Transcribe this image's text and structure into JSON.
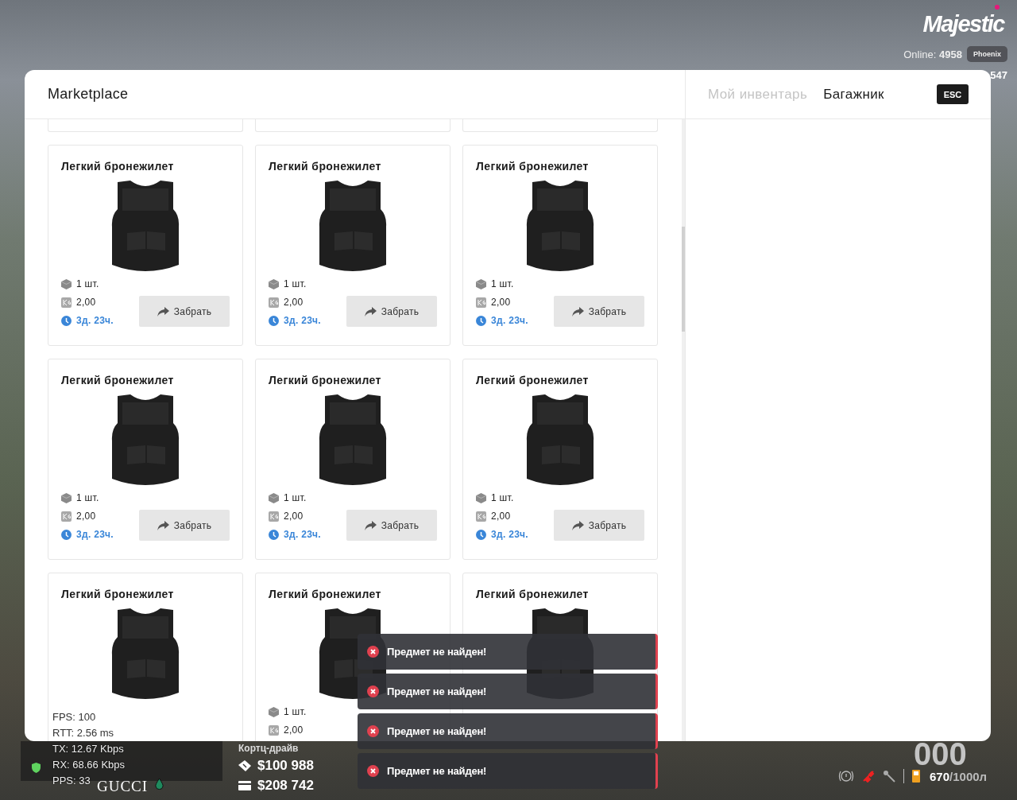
{
  "hud": {
    "logo": "Majestic",
    "online_label": "Online:",
    "online_count": "4958",
    "server": "Phoenix",
    "id_fragment": "547",
    "net_stats": [
      {
        "label": "FPS:",
        "value": "100"
      },
      {
        "label": "RTT:",
        "value": "2.56 ms"
      },
      {
        "label": "TX:",
        "value": "12.67 Kbps"
      },
      {
        "label": "RX:",
        "value": "68.66 Kbps"
      },
      {
        "label": "PPS:",
        "value": "33"
      }
    ],
    "brand": "GUCCI",
    "location": "Кортц-драйв",
    "cash": "$100 988",
    "bank": "$208 742",
    "speed": "000",
    "fuel": "670",
    "fuel_capacity": "/1000л"
  },
  "window": {
    "title": "Marketplace",
    "tabs": [
      {
        "label": "Мой инвентарь",
        "selected": false
      },
      {
        "label": "Багажник",
        "selected": true
      }
    ],
    "close_key": "ESC"
  },
  "cards": [
    {
      "title": "Легкий бронежилет",
      "quantity": "1 шт.",
      "weight": "2,00",
      "time": "3д. 23ч.",
      "button": "Забрать"
    },
    {
      "title": "Легкий бронежилет",
      "quantity": "1 шт.",
      "weight": "2,00",
      "time": "3д. 23ч.",
      "button": "Забрать"
    },
    {
      "title": "Легкий бронежилет",
      "quantity": "1 шт.",
      "weight": "2,00",
      "time": "3д. 23ч.",
      "button": "Забрать"
    },
    {
      "title": "Легкий бронежилет",
      "quantity": "1 шт.",
      "weight": "2,00",
      "time": "3д. 23ч.",
      "button": "Забрать"
    },
    {
      "title": "Легкий бронежилет",
      "quantity": "1 шт.",
      "weight": "2,00",
      "time": "3д. 23ч.",
      "button": "Забрать"
    },
    {
      "title": "Легкий бронежилет",
      "quantity": "1 шт.",
      "weight": "2,00",
      "time": "3д. 23ч.",
      "button": "Забрать"
    },
    {
      "title": "Легкий бронежилет"
    },
    {
      "title": "Легкий бронежилет",
      "quantity": "1 шт.",
      "weight": "2,00"
    },
    {
      "title": "Легкий бронежилет"
    }
  ],
  "notifications": [
    {
      "text": "Предмет не найден!"
    },
    {
      "text": "Предмет не найден!"
    },
    {
      "text": "Предмет не найден!"
    },
    {
      "text": "Предмет не найден!"
    }
  ]
}
